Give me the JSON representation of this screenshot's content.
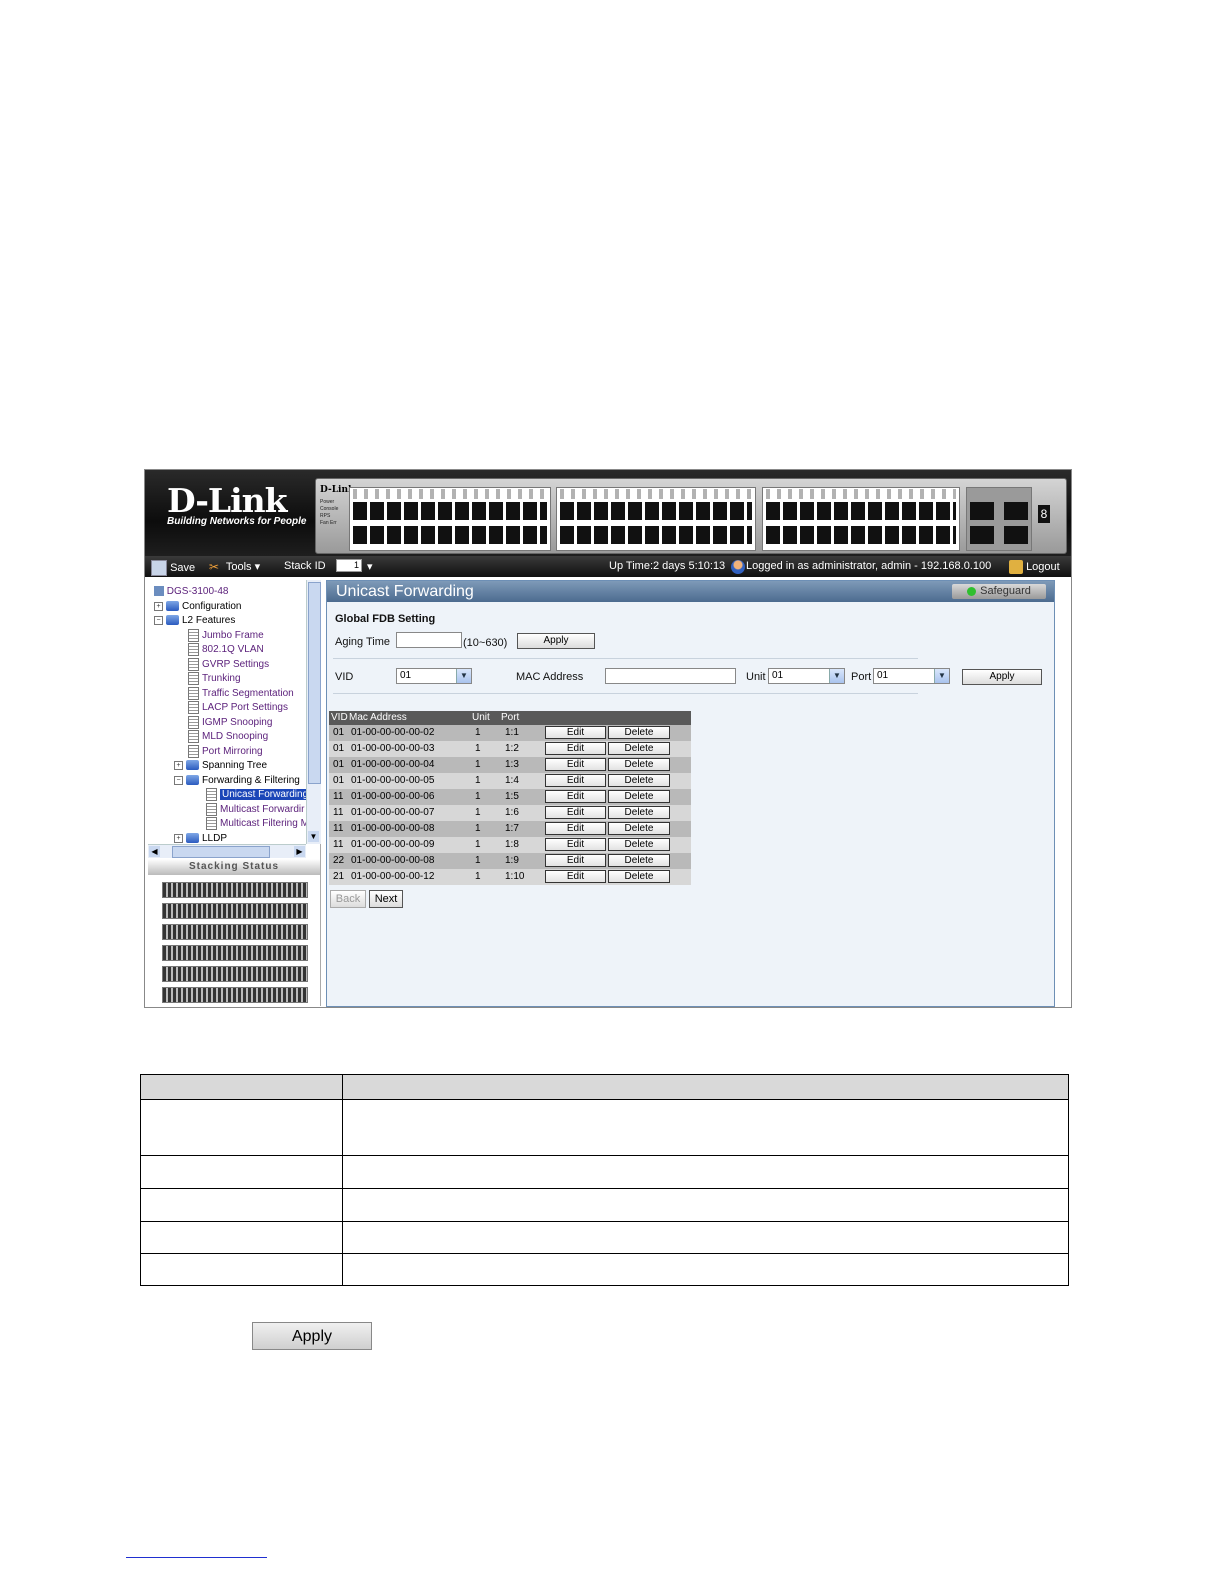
{
  "banner": {
    "brand": "D-Link",
    "tagline": "Building Networks for People",
    "panel_brand": "D-Link"
  },
  "panel_leds": [
    "Power",
    "Console",
    "RPS",
    "Fan Err"
  ],
  "toolbar": {
    "save_label": "Save",
    "tools_label": "Tools",
    "stack_id_label": "Stack ID",
    "stack_id_value": "1",
    "uptime": "Up Time:2 days 5:10:13",
    "logged_in": "Logged in as administrator, admin - 192.168.0.100",
    "logout_label": "Logout"
  },
  "tree": {
    "root": "DGS-3100-48",
    "configuration": "Configuration",
    "l2_features": "L2 Features",
    "items": [
      "Jumbo Frame",
      "802.1Q VLAN",
      "GVRP Settings",
      "Trunking",
      "Traffic Segmentation",
      "LACP Port Settings",
      "IGMP Snooping",
      "MLD Snooping",
      "Port Mirroring"
    ],
    "spanning_tree": "Spanning Tree",
    "forwarding": "Forwarding & Filtering",
    "sub_items": [
      "Unicast Forwarding",
      "Multicast Forwardir",
      "Multicast Filtering M"
    ],
    "lldp": "LLDP"
  },
  "stacking_status_label": "Stacking Status",
  "page": {
    "title": "Unicast Forwarding",
    "safeguard_label": "Safeguard",
    "global_fdb_label": "Global FDB Setting",
    "aging_time_label": "Aging Time",
    "aging_time_value": "",
    "aging_range": "(10~630)",
    "apply_label": "Apply",
    "vid_label": "VID",
    "vid_value": "01",
    "mac_label": "MAC Address",
    "mac_value": "",
    "unit_label": "Unit",
    "unit_value": "01",
    "port_label": "Port",
    "port_value": "01",
    "apply2_label": "Apply",
    "back_label": "Back",
    "next_label": "Next"
  },
  "table": {
    "headers": {
      "vid": "VID",
      "mac": "Mac Address",
      "unit": "Unit",
      "port": "Port"
    },
    "edit_label": "Edit",
    "delete_label": "Delete",
    "rows": [
      {
        "vid": "01",
        "mac": "01-00-00-00-00-02",
        "unit": "1",
        "port": "1:1"
      },
      {
        "vid": "01",
        "mac": "01-00-00-00-00-03",
        "unit": "1",
        "port": "1:2"
      },
      {
        "vid": "01",
        "mac": "01-00-00-00-00-04",
        "unit": "1",
        "port": "1:3"
      },
      {
        "vid": "01",
        "mac": "01-00-00-00-00-05",
        "unit": "1",
        "port": "1:4"
      },
      {
        "vid": "11",
        "mac": "01-00-00-00-00-06",
        "unit": "1",
        "port": "1:5"
      },
      {
        "vid": "11",
        "mac": "01-00-00-00-00-07",
        "unit": "1",
        "port": "1:6"
      },
      {
        "vid": "11",
        "mac": "01-00-00-00-00-08",
        "unit": "1",
        "port": "1:7"
      },
      {
        "vid": "11",
        "mac": "01-00-00-00-00-09",
        "unit": "1",
        "port": "1:8"
      },
      {
        "vid": "22",
        "mac": "01-00-00-00-00-08",
        "unit": "1",
        "port": "1:9"
      },
      {
        "vid": "21",
        "mac": "01-00-00-00-00-12",
        "unit": "1",
        "port": "1:10"
      }
    ]
  },
  "doc_apply_label": "Apply"
}
